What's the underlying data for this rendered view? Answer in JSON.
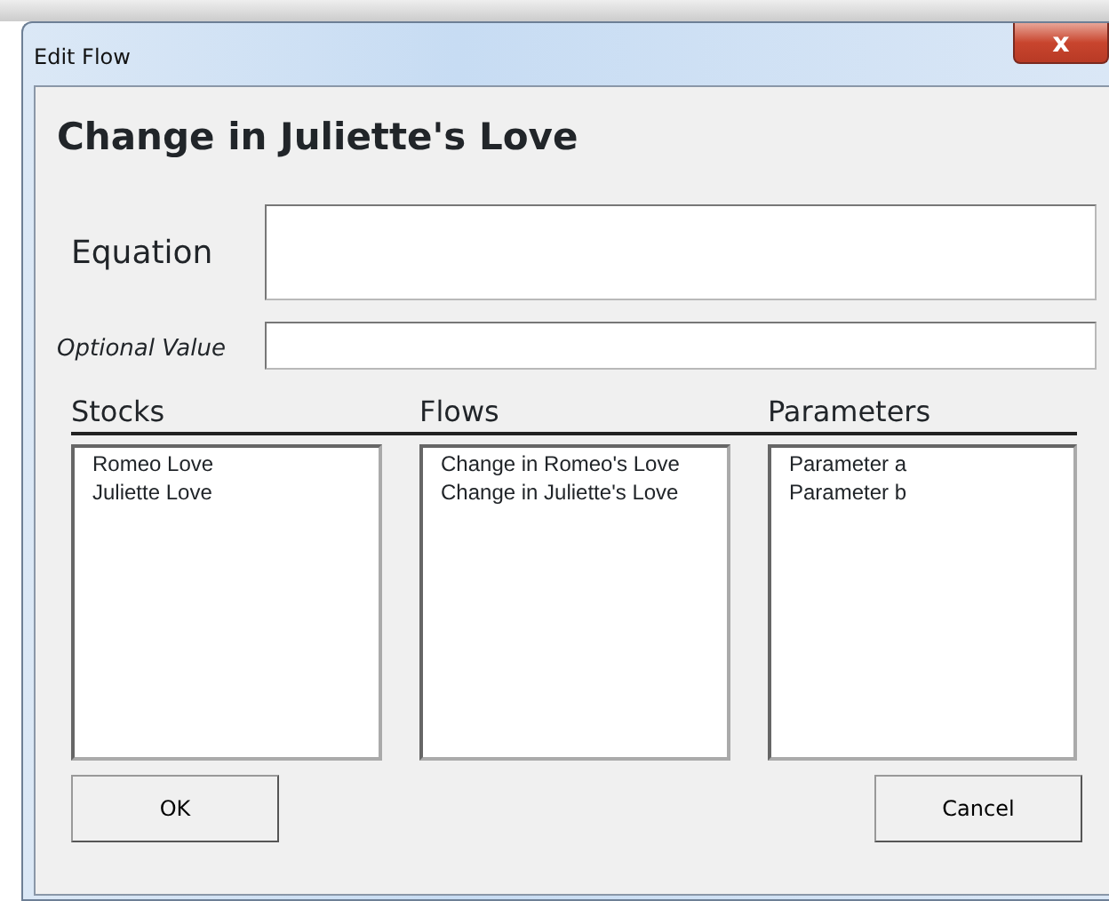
{
  "window": {
    "title": "Edit Flow",
    "close": "x"
  },
  "heading": "Change in Juliette's Love",
  "fields": [
    {
      "label": "Equation",
      "kind": "large"
    },
    {
      "label": "Optional Value",
      "kind": "small"
    }
  ],
  "lists": [
    {
      "title": "Stocks",
      "items": [
        "Romeo Love",
        "Juliette Love"
      ]
    },
    {
      "title": "Flows",
      "items": [
        "Change in Romeo's Love",
        "Change in Juliette's Love"
      ]
    },
    {
      "title": "Parameters",
      "items": [
        "Parameter a",
        "Parameter b"
      ]
    }
  ],
  "buttons": [
    "OK",
    "Cancel"
  ]
}
